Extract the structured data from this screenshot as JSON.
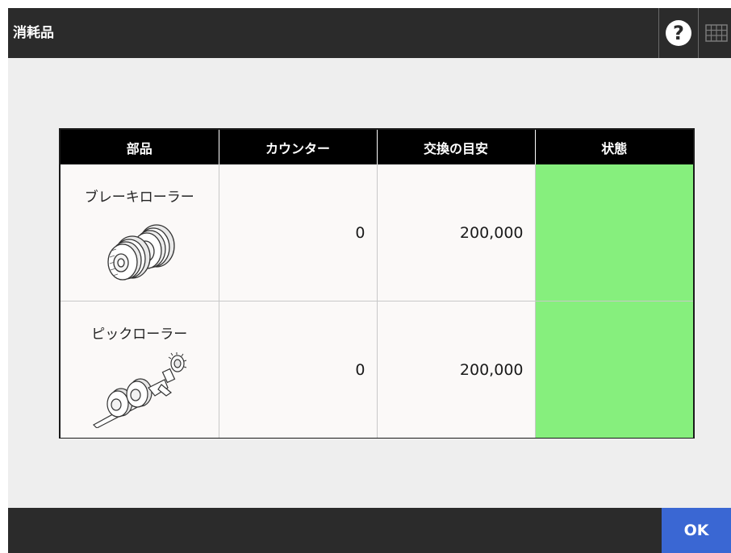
{
  "header": {
    "title": "消耗品",
    "help_label": "?"
  },
  "table": {
    "columns": [
      "部品",
      "カウンター",
      "交換の目安",
      "状態"
    ],
    "rows": [
      {
        "part": "ブレーキローラー",
        "counter": "0",
        "guide": "200,000",
        "status_color": "#86ef7d"
      },
      {
        "part": "ピックローラー",
        "counter": "0",
        "guide": "200,000",
        "status_color": "#86ef7d"
      }
    ]
  },
  "footer": {
    "ok_label": "OK"
  },
  "colors": {
    "header_bg": "#2b2b2b",
    "status_ok": "#86ef7d",
    "ok_button": "#3a67d3"
  }
}
